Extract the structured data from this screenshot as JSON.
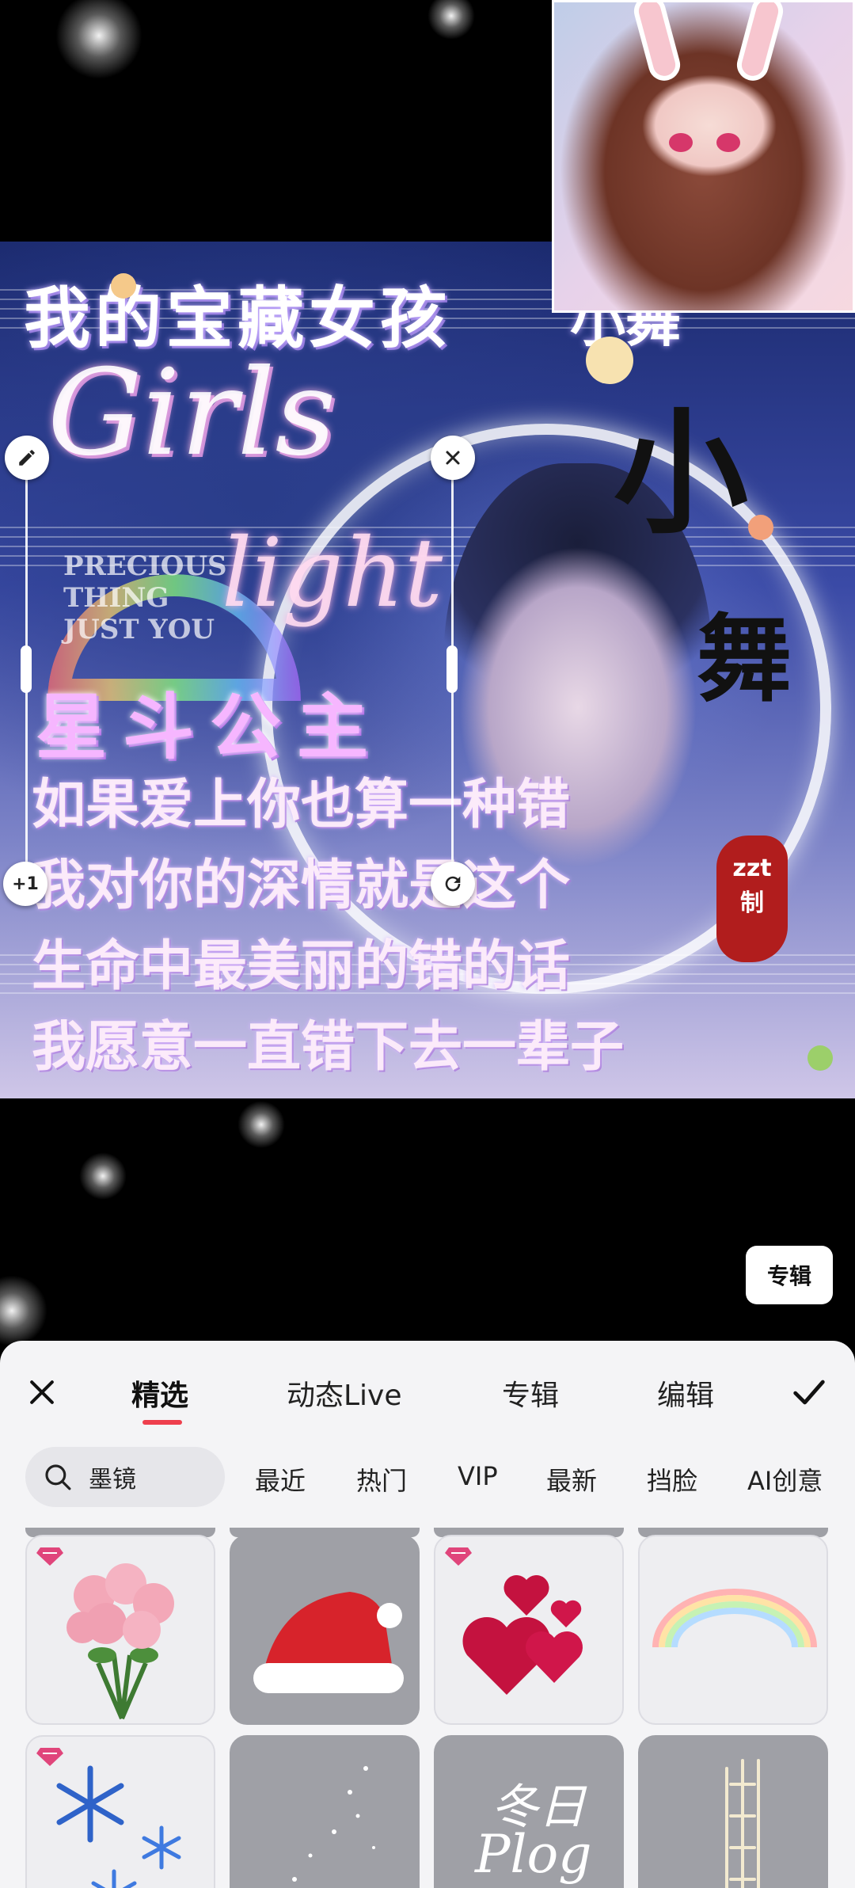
{
  "overlay": {
    "album_button": "专辑"
  },
  "collage": {
    "title": "我的宝藏女孩",
    "title_right": "小舞",
    "script_main": "Girls",
    "script_second": "light",
    "small_english": [
      "PRECIOUS",
      "THING",
      "JUST YOU"
    ],
    "character_big": "小",
    "character_second": "舞",
    "seal_text": [
      "zzt",
      "制"
    ],
    "subtitle": "星斗公主",
    "lyrics": [
      "如果爱上你也算一种错",
      "我对你的深情就是这个",
      "生命中最美丽的错的话",
      "我愿意一直错下去一辈子"
    ],
    "handle_plus": "+1"
  },
  "tabs": {
    "items": [
      "精选",
      "动态Live",
      "专辑",
      "编辑"
    ],
    "active": "精选"
  },
  "search": {
    "value": "墨镜"
  },
  "filters": [
    "最近",
    "热门",
    "VIP",
    "最新",
    "挡脸",
    "AI创意"
  ],
  "stickers": [
    {
      "name": "roses",
      "vip": true
    },
    {
      "name": "santa-hat",
      "vip": false
    },
    {
      "name": "hearts",
      "vip": true
    },
    {
      "name": "rainbow",
      "vip": false
    },
    {
      "name": "snowflakes",
      "vip": true
    },
    {
      "name": "star-constellation",
      "vip": false
    },
    {
      "name": "winter-plog",
      "vip": false,
      "text": "冬日",
      "subtext": "Plog"
    },
    {
      "name": "calligraphy",
      "vip": false
    }
  ],
  "colors": {
    "accent": "#ee3f4d",
    "vip_badge": "#e0457b",
    "panel_bg": "#f4f4f6"
  }
}
